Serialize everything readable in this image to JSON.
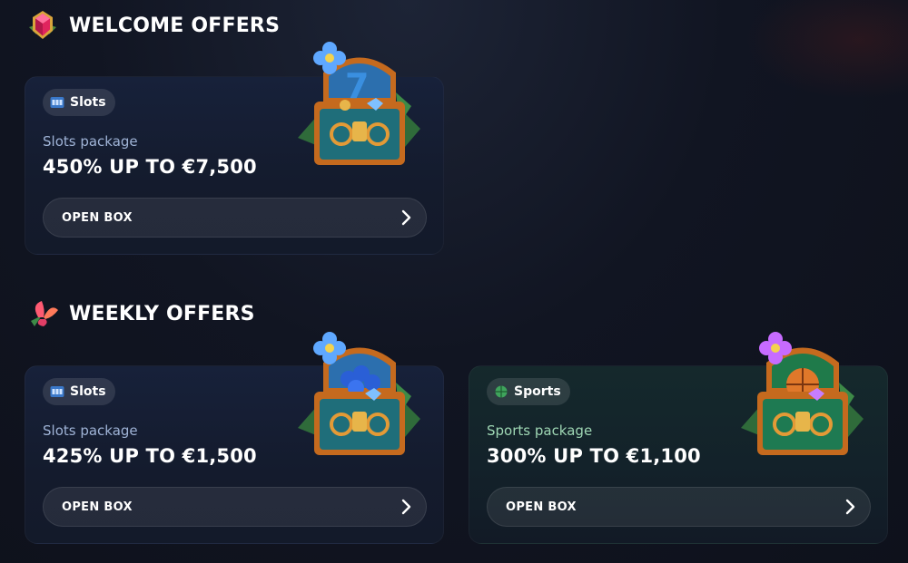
{
  "welcome": {
    "title": "WELCOME OFFERS",
    "offer": {
      "badge": "Slots",
      "package_label": "Slots package",
      "headline": "450% UP TO €7,500",
      "button": "OPEN BOX"
    }
  },
  "weekly": {
    "title": "WEEKLY OFFERS",
    "offers": [
      {
        "badge": "Slots",
        "package_label": "Slots package",
        "headline": "425% UP TO €1,500",
        "button": "OPEN BOX"
      },
      {
        "badge": "Sports",
        "package_label": "Sports package",
        "headline": "300% UP TO €1,100",
        "button": "OPEN BOX"
      }
    ]
  },
  "colors": {
    "background": "#111522",
    "card": "#17213a",
    "card_green": "#15292c",
    "slots_label": "#9fb3d6",
    "sports_label": "#9fd7b4"
  },
  "icons": {
    "welcome_title": "gem-icon",
    "weekly_title": "flower-icon",
    "slots_badge": "slot-machine-icon",
    "sports_badge": "sports-ball-icon",
    "button": "chevron-right-icon"
  }
}
